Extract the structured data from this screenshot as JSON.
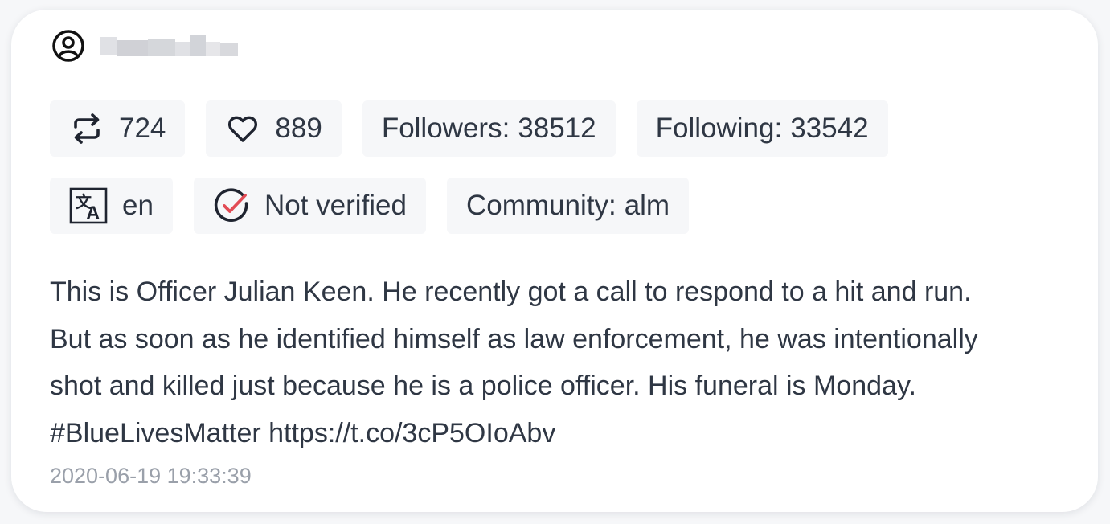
{
  "user": {
    "icon": "user-circle-icon",
    "username": "████ ███ ██"
  },
  "stats": {
    "retweets": "724",
    "likes": "889",
    "followers_label": "Followers:",
    "followers": "38512",
    "following_label": "Following:",
    "following": "33542"
  },
  "meta": {
    "language": "en",
    "verification": "Not verified",
    "community_label": "Community:",
    "community": "alm"
  },
  "tweet": {
    "text": "This is Officer Julian Keen. He recently got a call to respond to a hit and run.\nBut as soon as he identified himself as law enforcement, he was intentionally\nshot and killed just because he is a police officer. His funeral is Monday.\n#BlueLivesMatter https://t.co/3cP5OIoAbv",
    "timestamp": "2020-06-19 19:33:39"
  },
  "icons": {
    "retweet": "retweet-icon",
    "like": "heart-icon",
    "language": "translate-icon",
    "verified": "check-circle-icon"
  },
  "colors": {
    "text": "#2f3744",
    "pill_background": "#f6f7f9",
    "timestamp": "#9aa0aa",
    "accent_check": "#e24b55"
  }
}
